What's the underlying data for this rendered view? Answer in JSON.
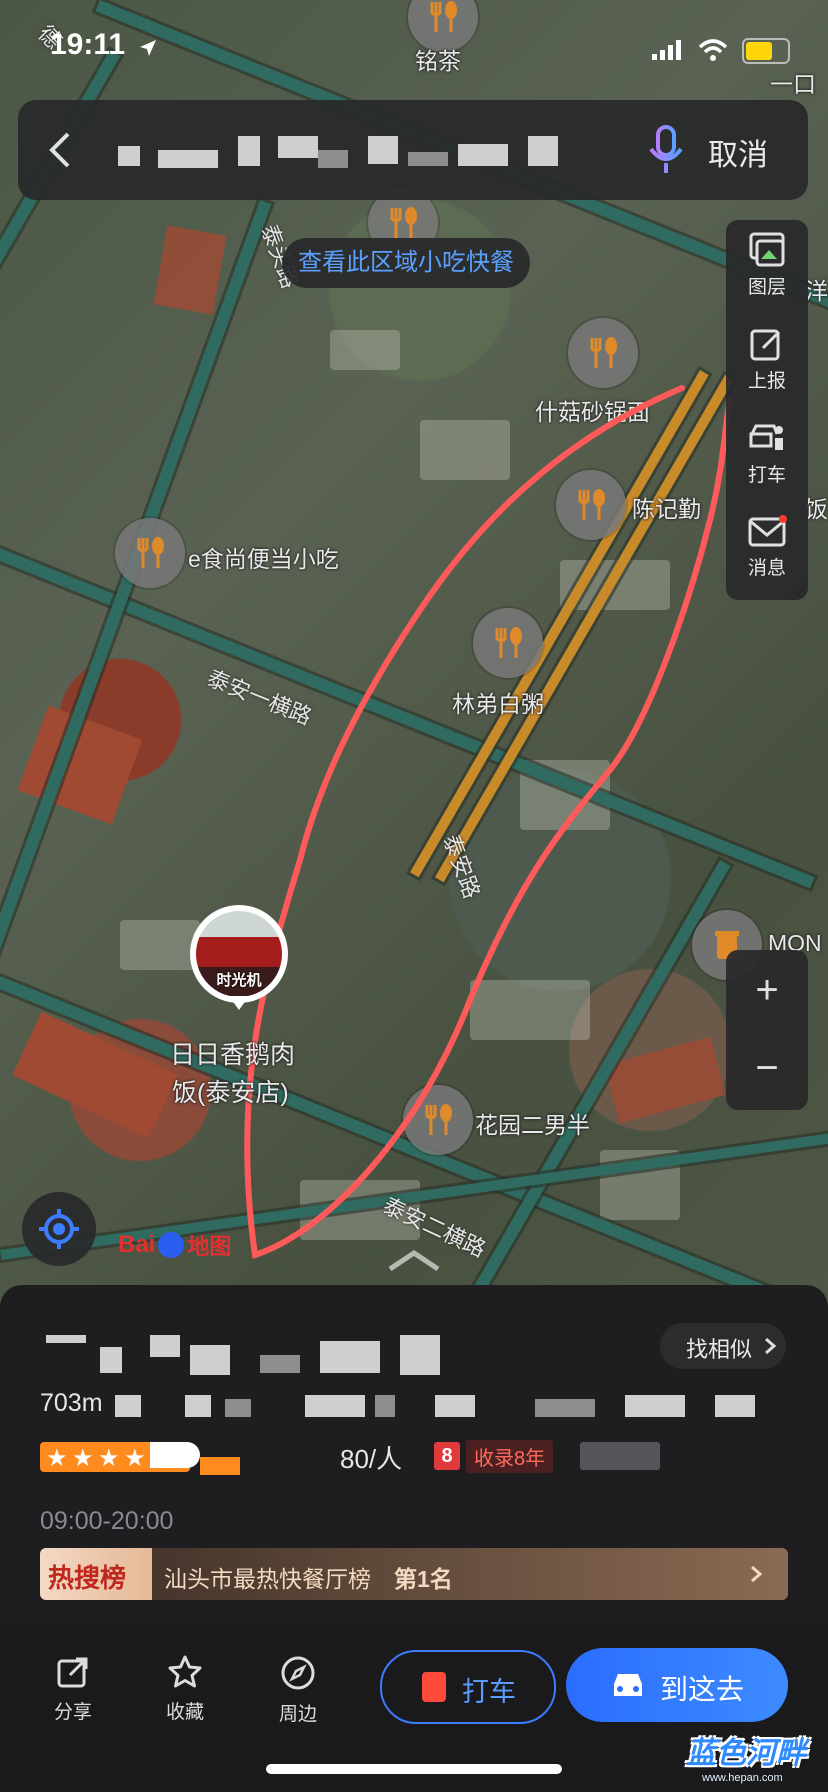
{
  "status": {
    "time": "19:11"
  },
  "search": {
    "cancel": "取消"
  },
  "banner": {
    "text": "查看此区域小吃快餐"
  },
  "tools": [
    {
      "label": "图层",
      "icon": "layers-icon"
    },
    {
      "label": "上报",
      "icon": "report-icon"
    },
    {
      "label": "打车",
      "icon": "taxi-icon"
    },
    {
      "label": "消息",
      "icon": "message-icon"
    }
  ],
  "zoom": {
    "in": "+",
    "out": "−"
  },
  "map": {
    "poi_labels": [
      "铭茶",
      "什菇砂锅面",
      "陈记勤",
      "饭",
      "e食尚便当小吃",
      "林弟白粥",
      "花园二男半",
      "MON",
      "洋",
      "一口"
    ],
    "road_labels": [
      "泰安一横路",
      "泰安路",
      "泰安二横路",
      "泰头路",
      "德",
      "泰"
    ],
    "marker": {
      "label": "时光机",
      "name_line1": "日日香鹅肉",
      "name_line2": "饭(泰安店)"
    },
    "logo": "地图",
    "logo_latin": "Bai"
  },
  "sheet": {
    "distance": "703m",
    "similar": "找相似",
    "price": "80/人",
    "badge_num": "8",
    "badge_text": "收录8年",
    "hours": "09:00-20:00",
    "hot_tag": "热搜榜",
    "hot_text": "汕头市最热快餐厅榜",
    "hot_rank": "第1名",
    "rating_stars": 5
  },
  "bottom": {
    "share": "分享",
    "favorite": "收藏",
    "nearby": "周边",
    "taxi": "打车",
    "go": "到这去"
  },
  "watermark": {
    "text": "蓝色河畔",
    "sub": "www.hepan.com"
  },
  "colors": {
    "accent": "#3d7bff",
    "route": "#ff5a5a",
    "orange": "#ff8a1e",
    "badge": "#e23a3a"
  }
}
